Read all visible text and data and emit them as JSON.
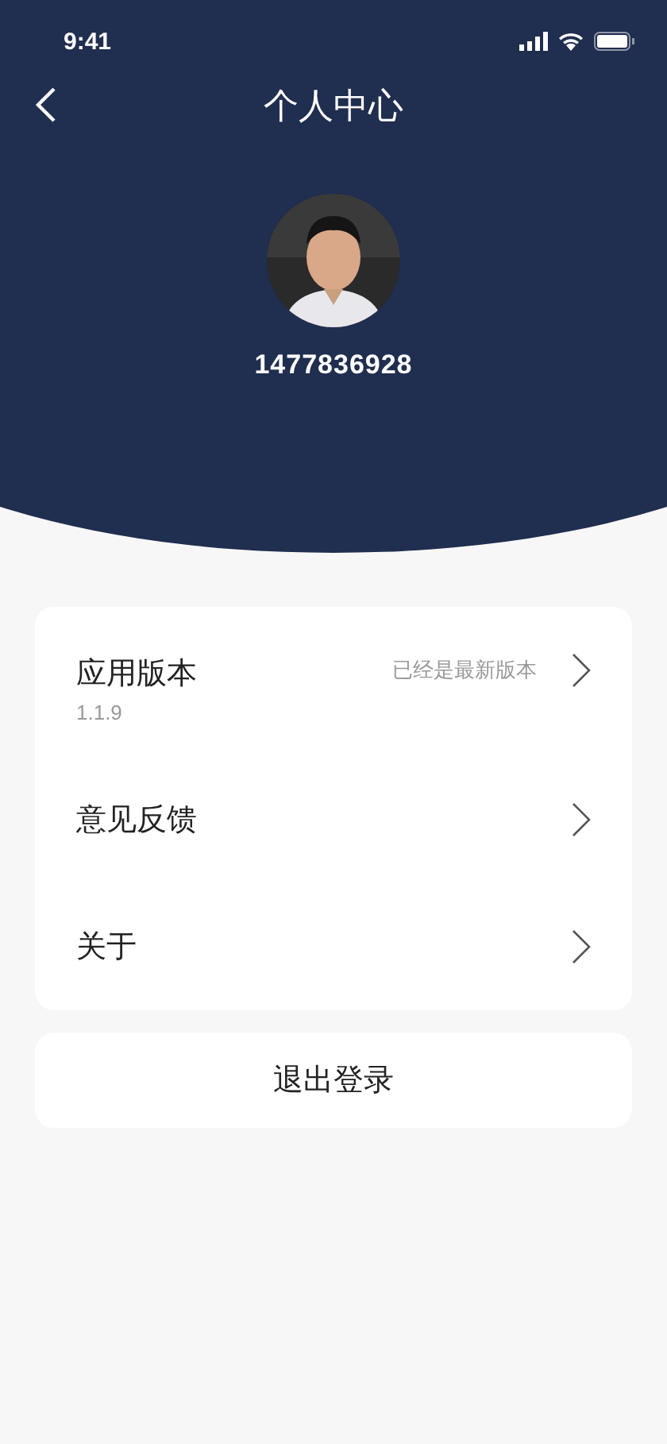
{
  "status_bar": {
    "time": "9:41"
  },
  "nav": {
    "title": "个人中心"
  },
  "profile": {
    "user_id": "1477836928"
  },
  "menu": [
    {
      "kind": "version",
      "label": "应用版本",
      "subtitle": "1.1.9",
      "status": "已经是最新版本"
    },
    {
      "kind": "link",
      "label": "意见反馈"
    },
    {
      "kind": "link",
      "label": "关于"
    }
  ],
  "logout_button": "退出登录"
}
